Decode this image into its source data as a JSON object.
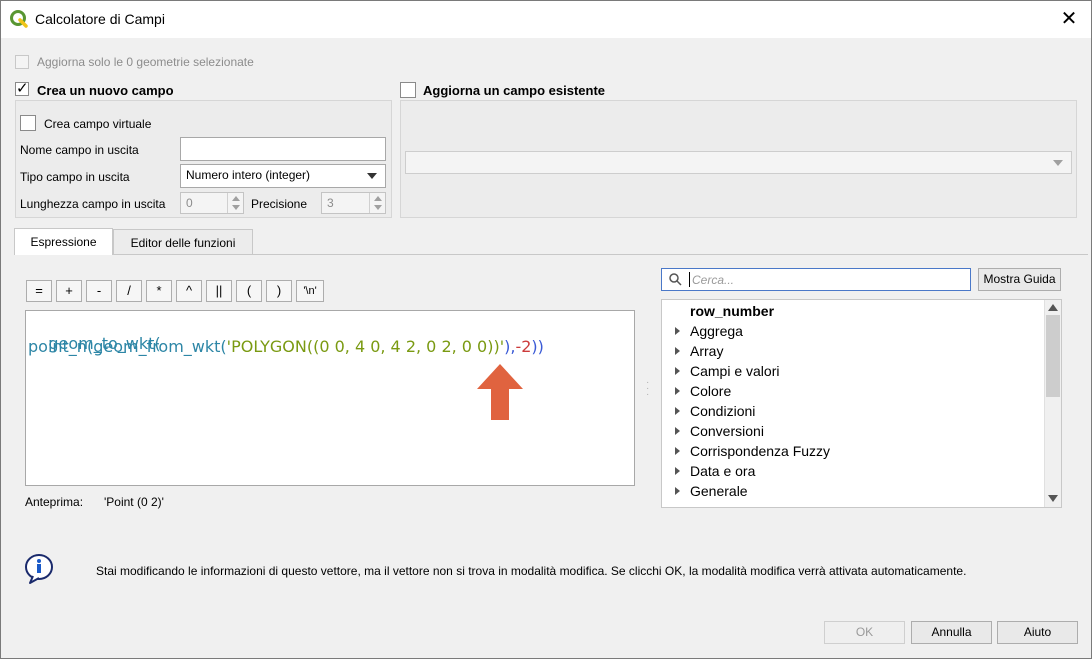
{
  "window": {
    "title": "Calcolatore di Campi",
    "close_symbol": "✕"
  },
  "update_selected": {
    "label": "Aggiorna solo le 0 geometrie selezionate",
    "checked": false
  },
  "new_field": {
    "label": "Crea un nuovo campo",
    "checked": true,
    "virtual_label": "Crea campo virtuale",
    "name_label": "Nome campo in uscita",
    "name_value": "",
    "type_label": "Tipo campo in uscita",
    "type_value": "Numero intero (integer)",
    "length_label": "Lunghezza campo in uscita",
    "length_value": "0",
    "precision_label": "Precisione",
    "precision_value": "3"
  },
  "existing_field": {
    "label": "Aggiorna un campo esistente",
    "checked": false,
    "combo_value": ""
  },
  "tabs": [
    {
      "label": "Espressione",
      "active": true
    },
    {
      "label": "Editor delle funzioni",
      "active": false
    }
  ],
  "operators": [
    "=",
    "+",
    "-",
    "/",
    "*",
    "^",
    "||",
    "(",
    ")",
    "'\\n'"
  ],
  "expression": {
    "line1": "geom_to_wkt(",
    "line2_fn1": "point_n(",
    "line2_fn2": "geom_from_wkt(",
    "line2_str": "'POLYGON((0 0, 4 0, 4 2, 0 2, 0 0))'",
    "line2_close1": ")",
    "line2_comma": ",",
    "line2_num": "-2",
    "line2_close2": "))"
  },
  "annotation": {
    "type": "arrow-up",
    "color": "#e0633f"
  },
  "preview": {
    "label": "Anteprima:",
    "value": "'Point (0 2)'"
  },
  "search": {
    "placeholder": "Cerca..."
  },
  "help_button": "Mostra Guida",
  "function_tree": [
    {
      "label": "row_number",
      "expandable": false,
      "bold": true
    },
    {
      "label": "Aggrega",
      "expandable": true
    },
    {
      "label": "Array",
      "expandable": true
    },
    {
      "label": "Campi e valori",
      "expandable": true
    },
    {
      "label": "Colore",
      "expandable": true
    },
    {
      "label": "Condizioni",
      "expandable": true
    },
    {
      "label": "Conversioni",
      "expandable": true
    },
    {
      "label": "Corrispondenza Fuzzy",
      "expandable": true
    },
    {
      "label": "Data e ora",
      "expandable": true
    },
    {
      "label": "Generale",
      "expandable": true
    }
  ],
  "info_message": "Stai modificando le informazioni di questo vettore, ma il vettore non si trova in modalità modifica. Se clicchi OK, la modalità modifica verrà attivata automaticamente.",
  "buttons": {
    "ok": "OK",
    "cancel": "Annulla",
    "help": "Aiuto"
  },
  "colors": {
    "accent": "#4a78c8",
    "function": "#2d86a6",
    "string": "#7a9a12",
    "number": "#cc3b3b",
    "paren": "#3b5bd6"
  }
}
